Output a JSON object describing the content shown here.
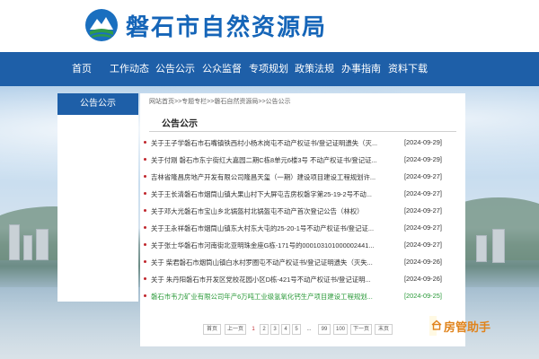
{
  "site": {
    "title": "磐石市自然资源局"
  },
  "nav": {
    "items": [
      {
        "label": "首页"
      },
      {
        "label": "工作动态"
      },
      {
        "label": "公告公示"
      },
      {
        "label": "公众监督"
      },
      {
        "label": "专项规划"
      },
      {
        "label": "政策法规"
      },
      {
        "label": "办事指南"
      },
      {
        "label": "资料下载"
      }
    ]
  },
  "sidebar": {
    "heading": "公告公示"
  },
  "breadcrumb": "网站首页>>专题专栏>>磐石自然资源局>>公告公示",
  "page_title": "公告公示",
  "announcements": [
    {
      "title": "关于王子学磐石市石嘴镇铁西村小杨木岗屯不动产权证书/登记证明遗失（灭...",
      "date": "[2024-09-29]"
    },
    {
      "title": "关于付刚 磐石市东宁街红大嘉园二期C栋8单元6楼3号 不动产权证书/登记证...",
      "date": "[2024-09-29]"
    },
    {
      "title": "吉林省隆昌房地产开发有限公司隆昌天玺（一期）建设项目建设工程规划许...",
      "date": "[2024-09-27]"
    },
    {
      "title": "关于王长清磐石市烟筒山镇大果山村下大屏屯吉房权磐字第25-19-2号不动...",
      "date": "[2024-09-27]"
    },
    {
      "title": "关于邓大光磐石市宝山乡北锅盔村北锅盔屯不动产首次登记公告（林权）",
      "date": "[2024-09-27]"
    },
    {
      "title": "关于王永祥磐石市烟筒山镇东大村东大屯的25-20-1号不动产权证书/登记证...",
      "date": "[2024-09-27]"
    },
    {
      "title": "关于张士华磐石市河南街北亚明珠金座G栋-171号的000103101000002441...",
      "date": "[2024-09-27]"
    },
    {
      "title": "关于 柴君磐石市烟筒山镇白水村罗圈屯不动产权证书/登记证明遗失（灭失...",
      "date": "[2024-09-26]"
    },
    {
      "title": "关于 朱丹阳磐石市开发区党校花园小区D栋-421号不动产权证书/登记证明...",
      "date": "[2024-09-26]"
    },
    {
      "title": "磐石市韦力矿业有限公司年产6万吨工业级氢氧化钙生产项目建设工程规划...",
      "date": "[2024-09-25]"
    }
  ],
  "pagination": {
    "items": [
      "首页",
      "上一页",
      "1",
      "2",
      "3",
      "4",
      "5",
      "...",
      "99",
      "100",
      "下一页",
      "末页"
    ],
    "current": "1"
  },
  "watermark": {
    "text": "房管助手",
    "icon": "house-logo-icon"
  },
  "colors": {
    "brand_blue": "#1e5fa8",
    "bullet_red": "#c0272d",
    "highlight_green": "#2b9a3a",
    "watermark_orange": "#e0841d"
  }
}
